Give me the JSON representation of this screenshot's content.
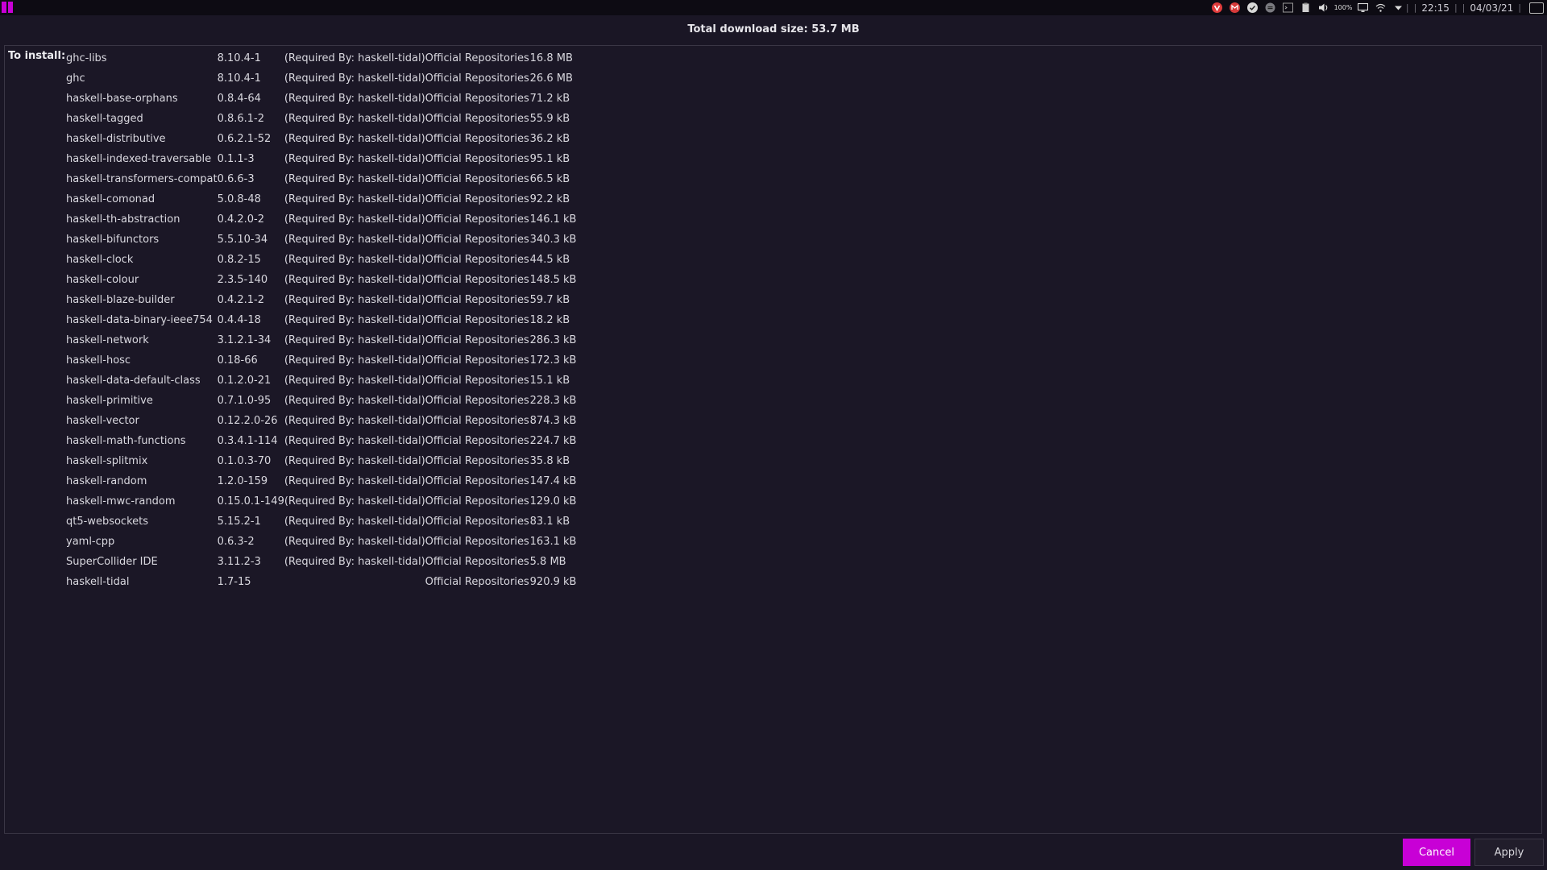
{
  "taskbar": {
    "tray_icons": [
      "vivaldi-icon",
      "gmail-icon",
      "check-icon",
      "chat-icon",
      "terminal-icon",
      "clipboard-icon",
      "volume-icon",
      "battery-icon",
      "display-icon",
      "wifi-icon",
      "chevron-down-icon"
    ],
    "battery_label": "100%",
    "time": "22:15",
    "date": "04/03/21",
    "accent_color": "#c800d6"
  },
  "dialog": {
    "total_download": "Total download size: 53.7 MB",
    "install_label": "To install:",
    "packages": [
      {
        "name": "ghc-libs",
        "version": "8.10.4-1",
        "required_by": "(Required By: haskell-tidal)",
        "repo": "Official Repositories",
        "size": "16.8 MB"
      },
      {
        "name": "ghc",
        "version": "8.10.4-1",
        "required_by": "(Required By: haskell-tidal)",
        "repo": "Official Repositories",
        "size": "26.6 MB"
      },
      {
        "name": "haskell-base-orphans",
        "version": "0.8.4-64",
        "required_by": "(Required By: haskell-tidal)",
        "repo": "Official Repositories",
        "size": "71.2 kB"
      },
      {
        "name": "haskell-tagged",
        "version": "0.8.6.1-2",
        "required_by": "(Required By: haskell-tidal)",
        "repo": "Official Repositories",
        "size": "55.9 kB"
      },
      {
        "name": "haskell-distributive",
        "version": "0.6.2.1-52",
        "required_by": "(Required By: haskell-tidal)",
        "repo": "Official Repositories",
        "size": "36.2 kB"
      },
      {
        "name": "haskell-indexed-traversable",
        "version": "0.1.1-3",
        "required_by": "(Required By: haskell-tidal)",
        "repo": "Official Repositories",
        "size": "95.1 kB"
      },
      {
        "name": "haskell-transformers-compat",
        "version": "0.6.6-3",
        "required_by": "(Required By: haskell-tidal)",
        "repo": "Official Repositories",
        "size": "66.5 kB"
      },
      {
        "name": "haskell-comonad",
        "version": "5.0.8-48",
        "required_by": "(Required By: haskell-tidal)",
        "repo": "Official Repositories",
        "size": "92.2 kB"
      },
      {
        "name": "haskell-th-abstraction",
        "version": "0.4.2.0-2",
        "required_by": "(Required By: haskell-tidal)",
        "repo": "Official Repositories",
        "size": "146.1 kB"
      },
      {
        "name": "haskell-bifunctors",
        "version": "5.5.10-34",
        "required_by": "(Required By: haskell-tidal)",
        "repo": "Official Repositories",
        "size": "340.3 kB"
      },
      {
        "name": "haskell-clock",
        "version": "0.8.2-15",
        "required_by": "(Required By: haskell-tidal)",
        "repo": "Official Repositories",
        "size": "44.5 kB"
      },
      {
        "name": "haskell-colour",
        "version": "2.3.5-140",
        "required_by": "(Required By: haskell-tidal)",
        "repo": "Official Repositories",
        "size": "148.5 kB"
      },
      {
        "name": "haskell-blaze-builder",
        "version": "0.4.2.1-2",
        "required_by": "(Required By: haskell-tidal)",
        "repo": "Official Repositories",
        "size": "59.7 kB"
      },
      {
        "name": "haskell-data-binary-ieee754",
        "version": "0.4.4-18",
        "required_by": "(Required By: haskell-tidal)",
        "repo": "Official Repositories",
        "size": "18.2 kB"
      },
      {
        "name": "haskell-network",
        "version": "3.1.2.1-34",
        "required_by": "(Required By: haskell-tidal)",
        "repo": "Official Repositories",
        "size": "286.3 kB"
      },
      {
        "name": "haskell-hosc",
        "version": "0.18-66",
        "required_by": "(Required By: haskell-tidal)",
        "repo": "Official Repositories",
        "size": "172.3 kB"
      },
      {
        "name": "haskell-data-default-class",
        "version": "0.1.2.0-21",
        "required_by": "(Required By: haskell-tidal)",
        "repo": "Official Repositories",
        "size": "15.1 kB"
      },
      {
        "name": "haskell-primitive",
        "version": "0.7.1.0-95",
        "required_by": "(Required By: haskell-tidal)",
        "repo": "Official Repositories",
        "size": "228.3 kB"
      },
      {
        "name": "haskell-vector",
        "version": "0.12.2.0-26",
        "required_by": "(Required By: haskell-tidal)",
        "repo": "Official Repositories",
        "size": "874.3 kB"
      },
      {
        "name": "haskell-math-functions",
        "version": "0.3.4.1-114",
        "required_by": "(Required By: haskell-tidal)",
        "repo": "Official Repositories",
        "size": "224.7 kB"
      },
      {
        "name": "haskell-splitmix",
        "version": "0.1.0.3-70",
        "required_by": "(Required By: haskell-tidal)",
        "repo": "Official Repositories",
        "size": "35.8 kB"
      },
      {
        "name": "haskell-random",
        "version": "1.2.0-159",
        "required_by": "(Required By: haskell-tidal)",
        "repo": "Official Repositories",
        "size": "147.4 kB"
      },
      {
        "name": "haskell-mwc-random",
        "version": "0.15.0.1-149",
        "required_by": "(Required By: haskell-tidal)",
        "repo": "Official Repositories",
        "size": "129.0 kB"
      },
      {
        "name": "qt5-websockets",
        "version": "5.15.2-1",
        "required_by": "(Required By: haskell-tidal)",
        "repo": "Official Repositories",
        "size": "83.1 kB"
      },
      {
        "name": "yaml-cpp",
        "version": "0.6.3-2",
        "required_by": "(Required By: haskell-tidal)",
        "repo": "Official Repositories",
        "size": "163.1 kB"
      },
      {
        "name": "SuperCollider IDE",
        "version": "3.11.2-3",
        "required_by": "(Required By: haskell-tidal)",
        "repo": "Official Repositories",
        "size": "5.8 MB"
      },
      {
        "name": "haskell-tidal",
        "version": "1.7-15",
        "required_by": "",
        "repo": "Official Repositories",
        "size": "920.9 kB"
      }
    ],
    "cancel_label": "Cancel",
    "apply_label": "Apply"
  }
}
